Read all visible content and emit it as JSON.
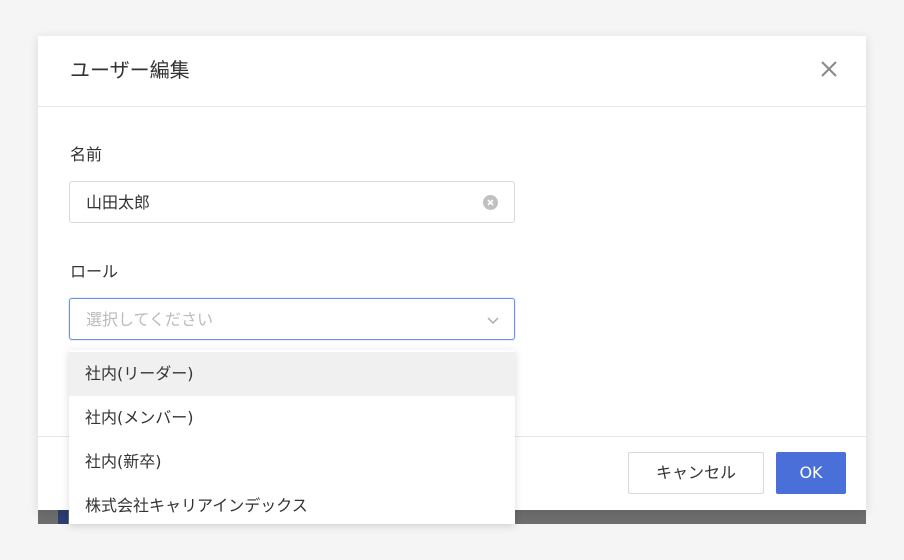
{
  "modal": {
    "title": "ユーザー編集",
    "close_icon": "close-icon"
  },
  "form": {
    "name_label": "名前",
    "name_value": "山田太郎",
    "clear_icon": "clear-circle-icon",
    "role_label": "ロール",
    "role_placeholder": "選択してください",
    "role_chevron_icon": "chevron-down-icon"
  },
  "dropdown": {
    "options": [
      {
        "label": "社内(リーダー)",
        "highlighted": true
      },
      {
        "label": "社内(メンバー)",
        "highlighted": false
      },
      {
        "label": "社内(新卒)",
        "highlighted": false
      },
      {
        "label": "株式会社キャリアインデックス",
        "highlighted": false
      }
    ]
  },
  "footer": {
    "cancel_label": "キャンセル",
    "ok_label": "OK"
  },
  "colors": {
    "primary": "#4a6fd8",
    "focus_border": "#6a8fe8",
    "placeholder": "#bbbbbb",
    "highlight_bg": "#f0f0f0"
  }
}
